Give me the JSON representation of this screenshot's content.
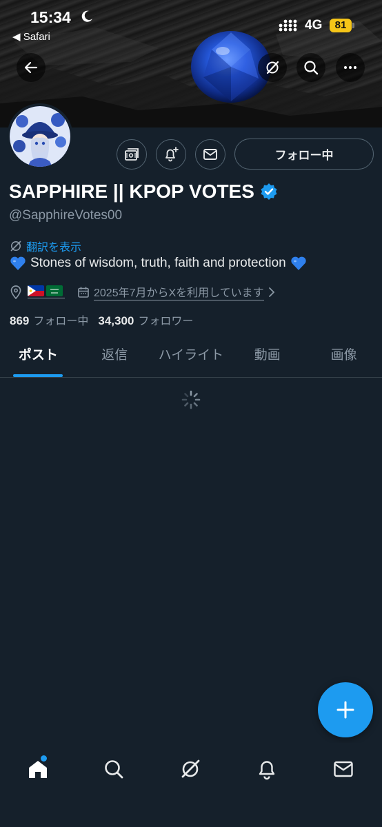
{
  "status_bar": {
    "time": "15:34",
    "back_app": "◀ Safari",
    "network": "4G",
    "battery": "81"
  },
  "profile": {
    "display_name": "SAPPHIRE || KPOP VOTES",
    "handle": "@SapphireVotes00",
    "translate_label": "翻訳を表示",
    "bio_text": "Stones of wisdom, truth, faith and protection",
    "joined": "2025年7月からXを利用しています",
    "following_count": "869",
    "following_label": "フォロー中",
    "followers_count": "34,300",
    "followers_label": "フォロワー"
  },
  "actions": {
    "follow_label": "フォロー中"
  },
  "tabs": [
    {
      "label": "ポスト",
      "active": true
    },
    {
      "label": "返信",
      "active": false
    },
    {
      "label": "ハイライト",
      "active": false
    },
    {
      "label": "動画",
      "active": false
    },
    {
      "label": "画像",
      "active": false
    }
  ],
  "colors": {
    "background": "#15202b",
    "accent": "#1d9bf0",
    "muted": "#8b98a5",
    "battery": "#f5c518"
  },
  "icons": {
    "header": [
      "back-arrow-icon",
      "grok-icon",
      "search-icon",
      "more-icon"
    ],
    "actions": [
      "subscriptions-icon",
      "notification-plus-icon",
      "message-icon"
    ],
    "bottom_nav": [
      "home-icon",
      "search-icon",
      "grok-icon",
      "notifications-icon",
      "messages-icon"
    ]
  }
}
